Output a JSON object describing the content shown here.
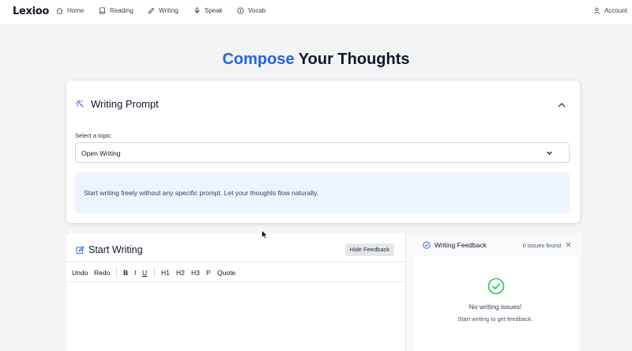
{
  "nav": {
    "logo": "Lexioo",
    "items": [
      {
        "label": "Home",
        "icon": "home-icon"
      },
      {
        "label": "Reading",
        "icon": "book-icon"
      },
      {
        "label": "Writing",
        "icon": "pencil-icon"
      },
      {
        "label": "Speak",
        "icon": "mic-icon"
      },
      {
        "label": "Vocab",
        "icon": "vocab-icon"
      }
    ],
    "account": "Account"
  },
  "heading": {
    "accent": "Compose",
    "rest": " Your Thoughts"
  },
  "prompt": {
    "title": "Writing Prompt",
    "topic_label": "Select a topic:",
    "selected_topic": "Open Writing",
    "description": "Start writing freely without any specific prompt. Let your thoughts flow naturally."
  },
  "editor": {
    "title": "Start Writing",
    "hide_feedback": "Hide Feedback",
    "toolbar": [
      "Undo",
      "Redo",
      "B",
      "I",
      "U",
      "H1",
      "H2",
      "H3",
      "P",
      "Quote"
    ]
  },
  "feedback": {
    "title": "Writing Feedback",
    "count": "0 issues found",
    "empty_title": "No writing issues!",
    "empty_sub": "Start writing to get feedback."
  },
  "colors": {
    "accent": "#2563eb",
    "success": "#22c55e",
    "info_bg": "#eef4ff"
  }
}
